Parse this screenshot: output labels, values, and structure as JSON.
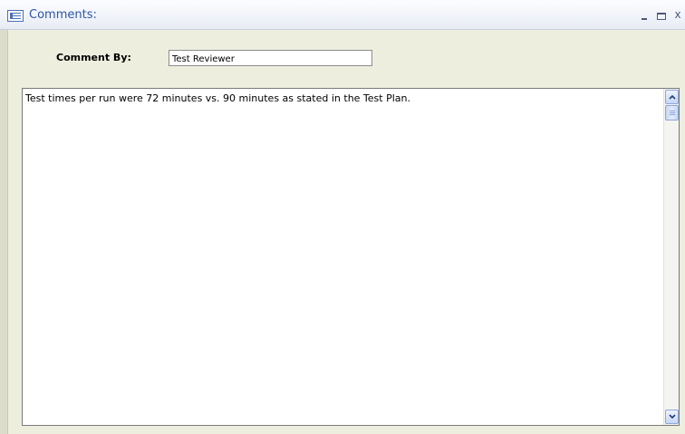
{
  "window": {
    "title": "Comments:",
    "minimize_label": "_",
    "close_label": "x",
    "accent": "#2a56a6",
    "background": "#eeeedf"
  },
  "form": {
    "comment_by_label": "Comment By:",
    "comment_by_value": "Test Reviewer",
    "comment_text": "Test times per run were 72 minutes vs. 90 minutes as stated in the Test Plan."
  },
  "icons": {
    "form": "form-icon",
    "minimize": "minimize-icon",
    "maximize": "maximize-icon",
    "close": "close-icon",
    "scroll_up": "chevron-up-icon",
    "scroll_down": "chevron-down-icon"
  }
}
